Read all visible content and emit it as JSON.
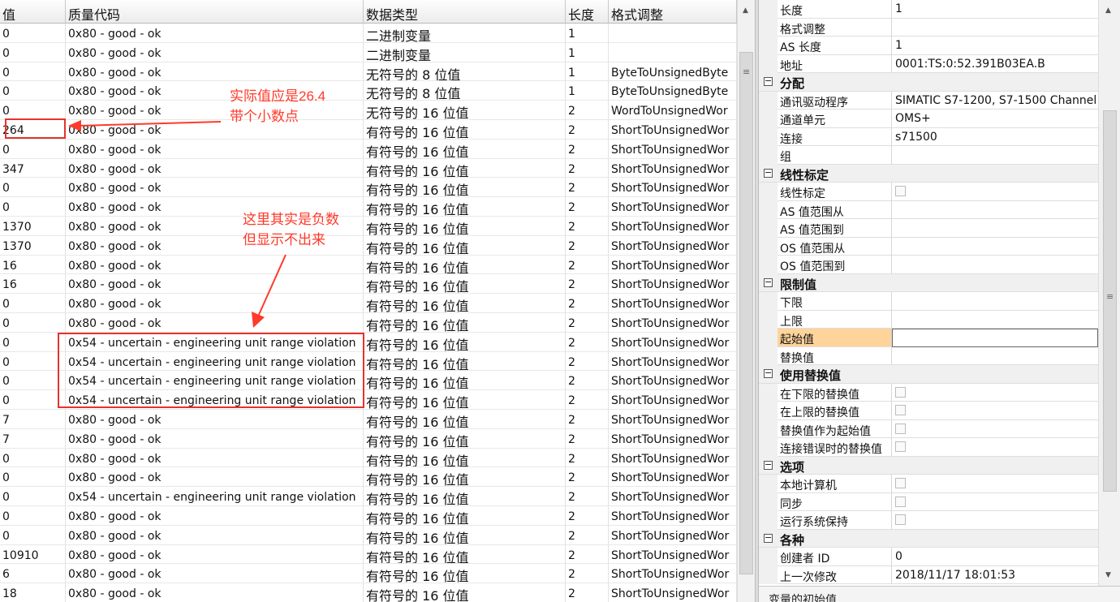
{
  "columns": {
    "value": "值",
    "quality": "质量代码",
    "type": "数据类型",
    "length": "长度",
    "format": "格式调整"
  },
  "rows": [
    {
      "value": "0",
      "quality": "0x80 - good - ok",
      "type": "二进制变量",
      "length": "1",
      "format": ""
    },
    {
      "value": "0",
      "quality": "0x80 - good - ok",
      "type": "二进制变量",
      "length": "1",
      "format": ""
    },
    {
      "value": "0",
      "quality": "0x80 - good - ok",
      "type": "无符号的 8 位值",
      "length": "1",
      "format": "ByteToUnsignedByte"
    },
    {
      "value": "0",
      "quality": "0x80 - good - ok",
      "type": "无符号的 8 位值",
      "length": "1",
      "format": "ByteToUnsignedByte"
    },
    {
      "value": "0",
      "quality": "0x80 - good - ok",
      "type": "无符号的 16 位值",
      "length": "2",
      "format": "WordToUnsignedWor"
    },
    {
      "value": "264",
      "quality": "0x80 - good - ok",
      "type": "有符号的 16 位值",
      "length": "2",
      "format": "ShortToUnsignedWor"
    },
    {
      "value": "0",
      "quality": "0x80 - good - ok",
      "type": "有符号的 16 位值",
      "length": "2",
      "format": "ShortToUnsignedWor"
    },
    {
      "value": "347",
      "quality": "0x80 - good - ok",
      "type": "有符号的 16 位值",
      "length": "2",
      "format": "ShortToUnsignedWor"
    },
    {
      "value": "0",
      "quality": "0x80 - good - ok",
      "type": "有符号的 16 位值",
      "length": "2",
      "format": "ShortToUnsignedWor"
    },
    {
      "value": "0",
      "quality": "0x80 - good - ok",
      "type": "有符号的 16 位值",
      "length": "2",
      "format": "ShortToUnsignedWor"
    },
    {
      "value": "1370",
      "quality": "0x80 - good - ok",
      "type": "有符号的 16 位值",
      "length": "2",
      "format": "ShortToUnsignedWor"
    },
    {
      "value": "1370",
      "quality": "0x80 - good - ok",
      "type": "有符号的 16 位值",
      "length": "2",
      "format": "ShortToUnsignedWor"
    },
    {
      "value": "16",
      "quality": "0x80 - good - ok",
      "type": "有符号的 16 位值",
      "length": "2",
      "format": "ShortToUnsignedWor"
    },
    {
      "value": "16",
      "quality": "0x80 - good - ok",
      "type": "有符号的 16 位值",
      "length": "2",
      "format": "ShortToUnsignedWor"
    },
    {
      "value": "0",
      "quality": "0x80 - good - ok",
      "type": "有符号的 16 位值",
      "length": "2",
      "format": "ShortToUnsignedWor"
    },
    {
      "value": "0",
      "quality": "0x80 - good - ok",
      "type": "有符号的 16 位值",
      "length": "2",
      "format": "ShortToUnsignedWor"
    },
    {
      "value": "0",
      "quality": "0x54 - uncertain - engineering unit range violation",
      "type": "有符号的 16 位值",
      "length": "2",
      "format": "ShortToUnsignedWor"
    },
    {
      "value": "0",
      "quality": "0x54 - uncertain - engineering unit range violation",
      "type": "有符号的 16 位值",
      "length": "2",
      "format": "ShortToUnsignedWor"
    },
    {
      "value": "0",
      "quality": "0x54 - uncertain - engineering unit range violation",
      "type": "有符号的 16 位值",
      "length": "2",
      "format": "ShortToUnsignedWor"
    },
    {
      "value": "0",
      "quality": "0x54 - uncertain - engineering unit range violation",
      "type": "有符号的 16 位值",
      "length": "2",
      "format": "ShortToUnsignedWor"
    },
    {
      "value": "7",
      "quality": "0x80 - good - ok",
      "type": "有符号的 16 位值",
      "length": "2",
      "format": "ShortToUnsignedWor"
    },
    {
      "value": "7",
      "quality": "0x80 - good - ok",
      "type": "有符号的 16 位值",
      "length": "2",
      "format": "ShortToUnsignedWor"
    },
    {
      "value": "0",
      "quality": "0x80 - good - ok",
      "type": "有符号的 16 位值",
      "length": "2",
      "format": "ShortToUnsignedWor"
    },
    {
      "value": "0",
      "quality": "0x80 - good - ok",
      "type": "有符号的 16 位值",
      "length": "2",
      "format": "ShortToUnsignedWor"
    },
    {
      "value": "0",
      "quality": "0x54 - uncertain - engineering unit range violation",
      "type": "有符号的 16 位值",
      "length": "2",
      "format": "ShortToUnsignedWor"
    },
    {
      "value": "0",
      "quality": "0x80 - good - ok",
      "type": "有符号的 16 位值",
      "length": "2",
      "format": "ShortToUnsignedWor"
    },
    {
      "value": "0",
      "quality": "0x80 - good - ok",
      "type": "有符号的 16 位值",
      "length": "2",
      "format": "ShortToUnsignedWor"
    },
    {
      "value": "10910",
      "quality": "0x80 - good - ok",
      "type": "有符号的 16 位值",
      "length": "2",
      "format": "ShortToUnsignedWor"
    },
    {
      "value": "6",
      "quality": "0x80 - good - ok",
      "type": "有符号的 16 位值",
      "length": "2",
      "format": "ShortToUnsignedWor"
    },
    {
      "value": "18",
      "quality": "0x80 - good - ok",
      "type": "有符号的 16 位值",
      "length": "2",
      "format": "ShortToUnsignedWor"
    }
  ],
  "annotations": {
    "note1_line1": "实际值应是26.4",
    "note1_line2": "带个小数点",
    "note2_line1": "这里其实是负数",
    "note2_line2": "但显示不出来",
    "color": "#ff3a2a"
  },
  "properties": [
    {
      "kind": "prop",
      "name": "长度",
      "value": "1"
    },
    {
      "kind": "prop",
      "name": "格式调整",
      "value": ""
    },
    {
      "kind": "prop",
      "name": "AS 长度",
      "value": "1"
    },
    {
      "kind": "prop",
      "name": "地址",
      "value": "0001:TS:0:52.391B03EA.B"
    },
    {
      "kind": "section",
      "name": "分配"
    },
    {
      "kind": "prop",
      "name": "通讯驱动程序",
      "value": "SIMATIC S7-1200, S7-1500 Channel"
    },
    {
      "kind": "prop",
      "name": "通道单元",
      "value": "OMS+"
    },
    {
      "kind": "prop",
      "name": "连接",
      "value": "s71500"
    },
    {
      "kind": "prop",
      "name": "组",
      "value": ""
    },
    {
      "kind": "section",
      "name": "线性标定"
    },
    {
      "kind": "check",
      "name": "线性标定",
      "value": ""
    },
    {
      "kind": "prop",
      "name": "AS 值范围从",
      "value": ""
    },
    {
      "kind": "prop",
      "name": "AS 值范围到",
      "value": ""
    },
    {
      "kind": "prop",
      "name": "OS 值范围从",
      "value": ""
    },
    {
      "kind": "prop",
      "name": "OS 值范围到",
      "value": ""
    },
    {
      "kind": "section",
      "name": "限制值"
    },
    {
      "kind": "prop",
      "name": "下限",
      "value": ""
    },
    {
      "kind": "prop",
      "name": "上限",
      "value": ""
    },
    {
      "kind": "prop",
      "name": "起始值",
      "value": "",
      "highlight": true
    },
    {
      "kind": "prop",
      "name": "替换值",
      "value": ""
    },
    {
      "kind": "section",
      "name": "使用替换值"
    },
    {
      "kind": "check",
      "name": "在下限的替换值",
      "value": ""
    },
    {
      "kind": "check",
      "name": "在上限的替换值",
      "value": ""
    },
    {
      "kind": "check",
      "name": "替换值作为起始值",
      "value": ""
    },
    {
      "kind": "check",
      "name": "连接错误时的替换值",
      "value": ""
    },
    {
      "kind": "section",
      "name": "选项"
    },
    {
      "kind": "check",
      "name": "本地计算机",
      "value": ""
    },
    {
      "kind": "check",
      "name": "同步",
      "value": ""
    },
    {
      "kind": "check",
      "name": "运行系统保持",
      "value": ""
    },
    {
      "kind": "section",
      "name": "各种"
    },
    {
      "kind": "prop",
      "name": "创建者 ID",
      "value": "0"
    },
    {
      "kind": "prop",
      "name": "上一次修改",
      "value": "2018/11/17 18:01:53"
    }
  ],
  "property_footer": "变量的初始值"
}
